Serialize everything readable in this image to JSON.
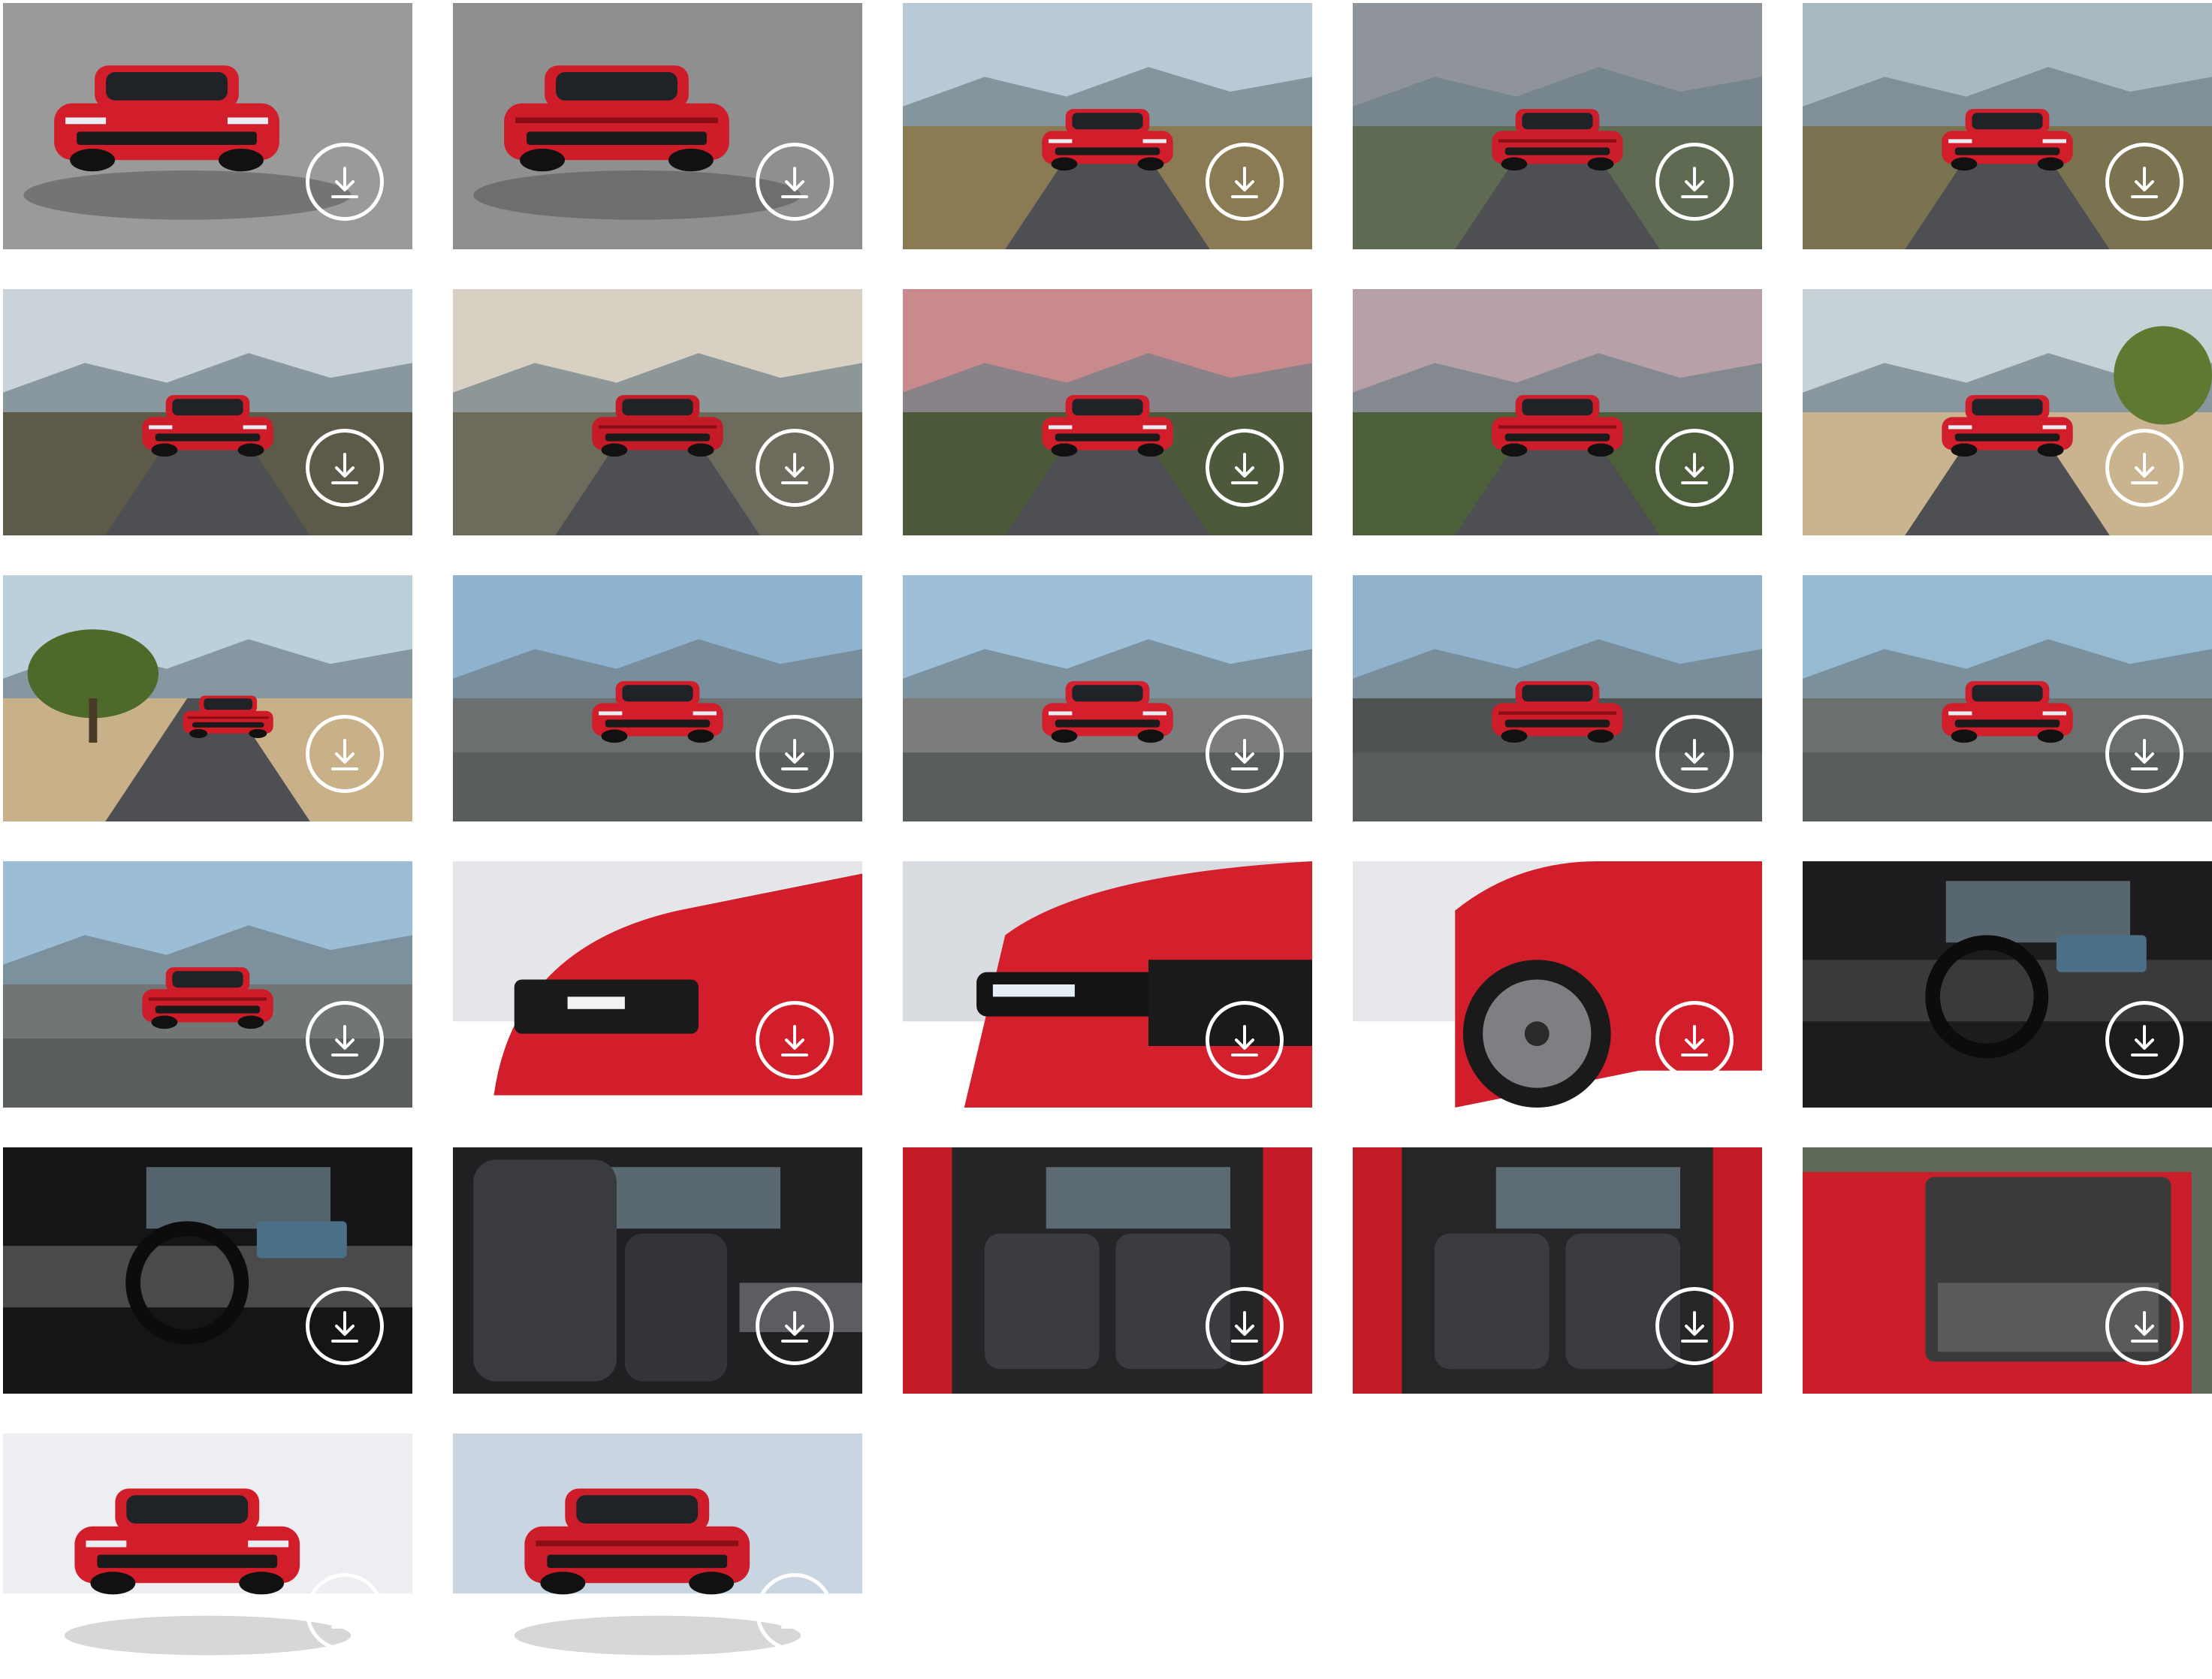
{
  "gallery": {
    "images": [
      {
        "scene": "studio",
        "subject": "suv-front-three-quarter-high",
        "download_icon": "download-icon",
        "colors": {
          "bg": "#9a9a9a",
          "car": "#d21d2b"
        }
      },
      {
        "scene": "studio",
        "subject": "suv-rear-three-quarter-high",
        "download_icon": "download-icon",
        "colors": {
          "bg": "#8f8f8f",
          "car": "#cf1c29"
        }
      },
      {
        "scene": "mountain-road",
        "subject": "suv-front-driving",
        "download_icon": "download-icon",
        "colors": {
          "sky": "#b9c9d6",
          "ground": "#8a7b55",
          "car": "#d21d2b"
        }
      },
      {
        "scene": "mountain-road",
        "subject": "suv-rear-driving",
        "download_icon": "download-icon",
        "colors": {
          "sky": "#8e9499",
          "ground": "#5f6a52",
          "car": "#cc1e2a"
        }
      },
      {
        "scene": "mountain-road",
        "subject": "suv-front-driving",
        "download_icon": "download-icon",
        "colors": {
          "sky": "#a9b9c2",
          "ground": "#7b7350",
          "car": "#d21d2b"
        }
      },
      {
        "scene": "road-motion",
        "subject": "suv-front-driving",
        "download_icon": "download-icon",
        "colors": {
          "sky": "#c9d3d9",
          "ground": "#5e5a49",
          "car": "#cf1c29"
        }
      },
      {
        "scene": "road-sunset",
        "subject": "suv-rear-driving",
        "download_icon": "download-icon",
        "colors": {
          "sky": "#d8d0c3",
          "ground": "#6d6b5c",
          "car": "#c51b27"
        }
      },
      {
        "scene": "sunset-hills",
        "subject": "suv-front-driving",
        "download_icon": "download-icon",
        "colors": {
          "sky": "#c98a8e",
          "ground": "#4c5a3b",
          "car": "#d21d2b"
        }
      },
      {
        "scene": "sunset-hills",
        "subject": "suv-rear-driving",
        "download_icon": "download-icon",
        "colors": {
          "sky": "#b8a0a8",
          "ground": "#4d5e3a",
          "car": "#cd1d2a"
        }
      },
      {
        "scene": "dirt-road",
        "subject": "suv-front-dust",
        "download_icon": "download-icon",
        "colors": {
          "sky": "#c7d2d6",
          "ground": "#c9b48f",
          "car": "#d21d2b"
        }
      },
      {
        "scene": "tree-field",
        "subject": "suv-rear-dust",
        "download_icon": "download-icon",
        "colors": {
          "sky": "#bcd0dc",
          "ground": "#c8b088",
          "car": "#cf1c29"
        }
      },
      {
        "scene": "mountain-view",
        "subject": "suv-front-three-quarter",
        "download_icon": "download-icon",
        "colors": {
          "sky": "#8fb3cf",
          "ground": "#6b6f6f",
          "car": "#d21d2b"
        }
      },
      {
        "scene": "mountain-view",
        "subject": "suv-side-profile",
        "download_icon": "download-icon",
        "colors": {
          "sky": "#9dc0d8",
          "ground": "#7a7d7c",
          "car": "#d4202d"
        }
      },
      {
        "scene": "mountain-view",
        "subject": "suv-rear-three-quarter",
        "download_icon": "download-icon",
        "colors": {
          "sky": "#90b2cc",
          "ground": "#4f5252",
          "car": "#cd1d2a"
        }
      },
      {
        "scene": "mountain-view",
        "subject": "suv-front",
        "download_icon": "download-icon",
        "colors": {
          "sky": "#97bad3",
          "ground": "#6c6f70",
          "car": "#d21d2b"
        }
      },
      {
        "scene": "mountain-view",
        "subject": "suv-rear",
        "download_icon": "download-icon",
        "colors": {
          "sky": "#9bbdd6",
          "ground": "#727575",
          "car": "#cf1c29"
        }
      },
      {
        "scene": "studio-white",
        "subject": "front-detail",
        "download_icon": "download-icon",
        "colors": {
          "bg": "#e4e6ea",
          "car": "#d21d2b"
        }
      },
      {
        "scene": "studio-white",
        "subject": "headlight-detail",
        "download_icon": "download-icon",
        "colors": {
          "bg": "#d9dde2",
          "car": "#d4202d"
        }
      },
      {
        "scene": "studio-white",
        "subject": "wheel-detail",
        "download_icon": "download-icon",
        "colors": {
          "bg": "#e6e8ec",
          "car": "#d21d2b"
        }
      },
      {
        "scene": "interior",
        "subject": "cockpit-wide",
        "download_icon": "download-icon",
        "colors": {
          "bg": "#1c1c1e",
          "trim": "#3a3a3c"
        }
      },
      {
        "scene": "interior",
        "subject": "steering-wheel",
        "download_icon": "download-icon",
        "colors": {
          "bg": "#151517",
          "trim": "#4a4a4c"
        }
      },
      {
        "scene": "interior",
        "subject": "front-seats",
        "download_icon": "download-icon",
        "colors": {
          "bg": "#202023",
          "trim": "#5b5d60"
        }
      },
      {
        "scene": "interior",
        "subject": "rear-seats-open-door",
        "download_icon": "download-icon",
        "colors": {
          "bg": "#252527",
          "trim": "#c51b27"
        }
      },
      {
        "scene": "interior",
        "subject": "rear-seats-open-door",
        "download_icon": "download-icon",
        "colors": {
          "bg": "#262628",
          "trim": "#c51b27"
        }
      },
      {
        "scene": "trunk",
        "subject": "open-tailgate",
        "download_icon": "download-icon",
        "colors": {
          "bg": "#3a3a3a",
          "car": "#cc1e2a"
        }
      },
      {
        "scene": "studio-white",
        "subject": "suv-top-front",
        "download_icon": "download-icon",
        "colors": {
          "bg": "#eceef1",
          "car": "#d21d2b"
        }
      },
      {
        "scene": "studio-white",
        "subject": "suv-rear-top",
        "download_icon": "download-icon",
        "colors": {
          "bg": "#c9d6e2",
          "car": "#cd1d2a"
        }
      }
    ]
  }
}
